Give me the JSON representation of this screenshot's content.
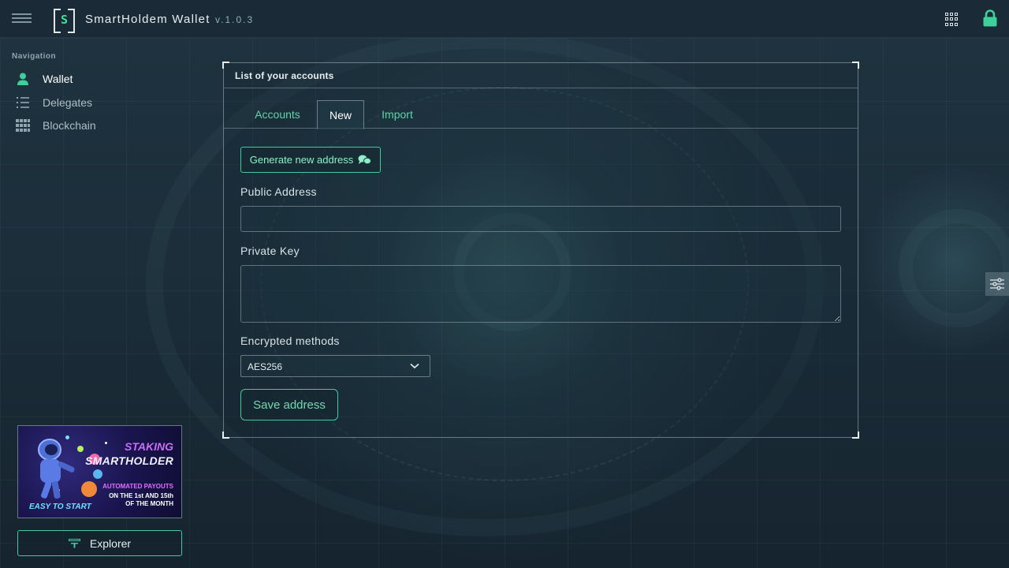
{
  "header": {
    "app_title": "SmartHoldem Wallet",
    "version": "v.1.0.3",
    "logo_letter": "S",
    "menu_icon": "hamburger-icon",
    "apps_icon": "apps-grid-icon",
    "lock_icon": "lock-icon"
  },
  "sidebar": {
    "heading": "Navigation",
    "items": [
      {
        "label": "Wallet",
        "icon": "person-icon",
        "active": true
      },
      {
        "label": "Delegates",
        "icon": "list-icon",
        "active": false
      },
      {
        "label": "Blockchain",
        "icon": "grid-icon",
        "active": false
      }
    ],
    "banner": {
      "line1": "STAKING",
      "line2": "SMARTHOLDER",
      "line3": "AUTOMATED PAYOUTS",
      "line4": "ON THE 1st AND 15th",
      "line5": "OF THE MONTH",
      "line6": "EASY TO START"
    },
    "explorer_label": "Explorer"
  },
  "panel": {
    "title": "List of your accounts",
    "tabs": [
      {
        "label": "Accounts",
        "active": false
      },
      {
        "label": "New",
        "active": true
      },
      {
        "label": "Import",
        "active": false
      }
    ],
    "generate_label": "Generate new address",
    "public_address_label": "Public Address",
    "public_address_value": "",
    "private_key_label": "Private Key",
    "private_key_value": "",
    "encrypted_label": "Encrypted methods",
    "encrypted_selected": "AES256",
    "save_label": "Save address"
  },
  "colors": {
    "accent": "#43c9a0",
    "tab_text": "#5fd3a9",
    "background": "#1b2e3a"
  }
}
